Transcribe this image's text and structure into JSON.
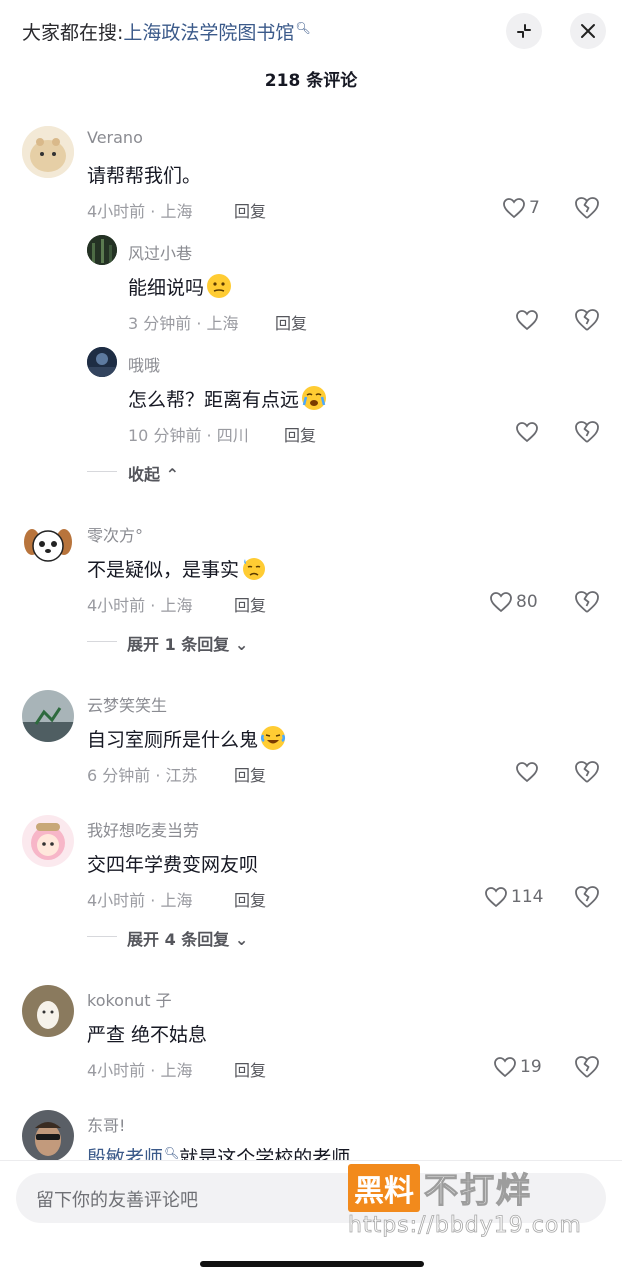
{
  "header": {
    "search_prefix": "大家都在搜:",
    "search_term": "上海政法学院图书馆",
    "title": "218 条评论"
  },
  "comments": [
    {
      "user": "Verano",
      "text": "请帮帮我们。",
      "meta": "4小时前 · 上海",
      "reply": "回复",
      "likes": "7"
    },
    {
      "user": "风过小巷",
      "text": "能细说吗",
      "meta": "3 分钟前 · 上海",
      "reply": "回复",
      "likes": ""
    },
    {
      "user": "哦哦",
      "text": "怎么帮？距离有点远",
      "meta": "10 分钟前 · 四川",
      "reply": "回复",
      "likes": ""
    },
    {
      "user": "零次方°",
      "text": "不是疑似，是事实",
      "meta": "4小时前 · 上海",
      "reply": "回复",
      "likes": "80"
    },
    {
      "user": "云梦笑笑生",
      "text": "自习室厕所是什么鬼",
      "meta": "6 分钟前 · 江苏",
      "reply": "回复",
      "likes": ""
    },
    {
      "user": "我好想吃麦当劳",
      "text": "交四年学费变网友呗",
      "meta": "4小时前 · 上海",
      "reply": "回复",
      "likes": "114"
    },
    {
      "user": "kokonut 子",
      "text": "严查 绝不姑息",
      "meta": "4小时前 · 上海",
      "reply": "回复",
      "likes": "19"
    },
    {
      "user": "东哥!",
      "text": "就是这个学校的老师",
      "mention": "殷敏老师",
      "meta": "",
      "reply": "",
      "likes": ""
    }
  ],
  "threads": {
    "collapse": "收起",
    "expand_1": "展开 1 条回复",
    "expand_4": "展开 4 条回复"
  },
  "input": {
    "placeholder": "留下你的友善评论吧"
  },
  "watermark": {
    "box": "黑料",
    "text": "不打烊",
    "url": "https://bbdy19.com"
  },
  "colors": {
    "accent_link": "#3b5a8a",
    "watermark_orange": "#f28a1c"
  }
}
